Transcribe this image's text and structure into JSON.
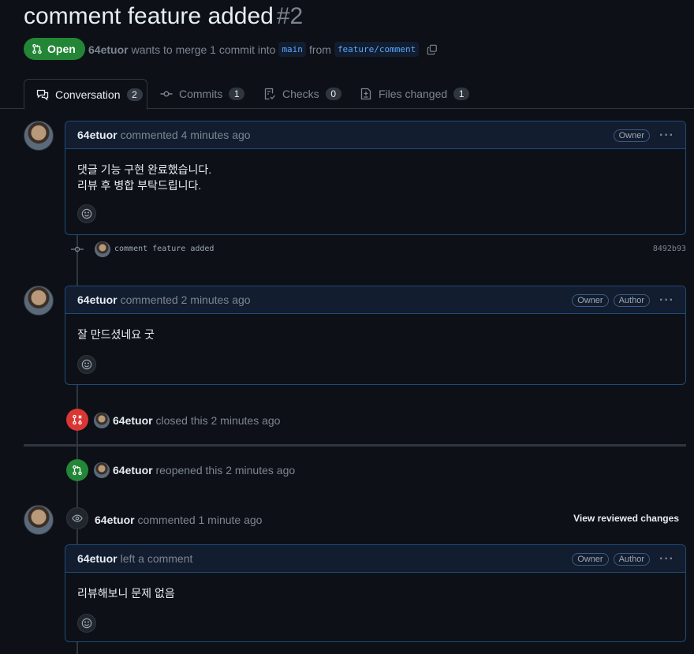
{
  "pr": {
    "title": "comment feature added",
    "number": "#2",
    "state": "Open",
    "author": "64etuor",
    "merge_text": "wants to merge 1 commit into",
    "base_branch": "main",
    "from_text": "from",
    "head_branch": "feature/comment"
  },
  "tabs": [
    {
      "label": "Conversation",
      "count": "2"
    },
    {
      "label": "Commits",
      "count": "1"
    },
    {
      "label": "Checks",
      "count": "0"
    },
    {
      "label": "Files changed",
      "count": "1"
    }
  ],
  "comments": [
    {
      "author": "64etuor",
      "meta": "commented 4 minutes ago",
      "roles": [
        "Owner"
      ],
      "body_lines": [
        "댓글 기능 구현 완료했습니다.",
        "리뷰 후 병합 부탁드립니다."
      ]
    },
    {
      "author": "64etuor",
      "meta": "commented 2 minutes ago",
      "roles": [
        "Owner",
        "Author"
      ],
      "body_lines": [
        "잘 만드셨네요 굿"
      ]
    },
    {
      "author": "64etuor",
      "meta": "left a comment",
      "roles": [
        "Owner",
        "Author"
      ],
      "body_lines": [
        "리뷰해보니 문제 없음"
      ]
    }
  ],
  "commit": {
    "message": "comment feature added",
    "sha": "8492b93"
  },
  "events": {
    "closed": {
      "user": "64etuor",
      "text": "closed this 2 minutes ago",
      "color": "#da3633"
    },
    "reopened": {
      "user": "64etuor",
      "text": "reopened this 2 minutes ago",
      "color": "#238636"
    },
    "review": {
      "user": "64etuor",
      "text": "commented 1 minute ago",
      "link": "View reviewed changes"
    }
  },
  "colors": {
    "open_green": "#238636",
    "closed_red": "#da3633",
    "accent_blue": "#58a6ff"
  },
  "icons": {
    "state": "git-pull-request-icon",
    "copy": "copy-icon",
    "review": "eye-icon"
  }
}
